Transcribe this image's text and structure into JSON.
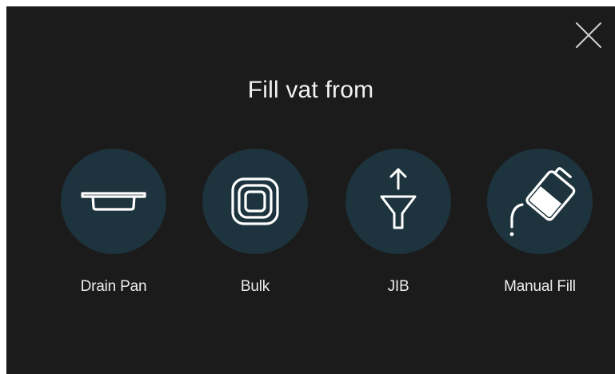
{
  "dialog": {
    "title": "Fill vat from",
    "close_icon": "close-icon"
  },
  "options": [
    {
      "label": "Drain Pan",
      "icon": "drain-pan-icon"
    },
    {
      "label": "Bulk",
      "icon": "bulk-icon"
    },
    {
      "label": "JIB",
      "icon": "jib-icon"
    },
    {
      "label": "Manual Fill",
      "icon": "manual-fill-icon"
    }
  ],
  "colors": {
    "background": "#1b1b1b",
    "circle": "#1d333d",
    "text": "#f2f2f2"
  }
}
